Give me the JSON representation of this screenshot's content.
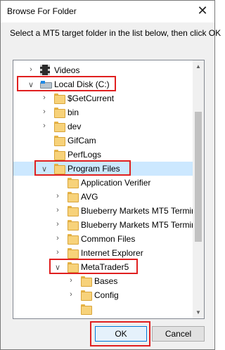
{
  "window": {
    "title": "Browse For Folder",
    "close_glyph": "✕"
  },
  "instruction": "Select a MT5 target folder in the list below, then click OK",
  "tree": {
    "items": [
      {
        "label": "Videos",
        "expanded": false,
        "icon": "video-library-icon"
      },
      {
        "label": "Local Disk (C:)",
        "expanded": true,
        "icon": "drive-icon"
      },
      {
        "label": "$GetCurrent",
        "expanded": false,
        "icon": "folder-icon"
      },
      {
        "label": "bin",
        "expanded": false,
        "icon": "folder-icon"
      },
      {
        "label": "dev",
        "expanded": false,
        "icon": "folder-icon"
      },
      {
        "label": "GifCam",
        "expanded": false,
        "icon": "folder-icon"
      },
      {
        "label": "PerfLogs",
        "expanded": false,
        "icon": "folder-icon"
      },
      {
        "label": "Program Files",
        "expanded": true,
        "icon": "folder-icon"
      },
      {
        "label": "Application Verifier",
        "expanded": false,
        "icon": "folder-icon"
      },
      {
        "label": "AVG",
        "expanded": false,
        "icon": "folder-icon"
      },
      {
        "label": "Blueberry Markets MT5 Termin",
        "expanded": false,
        "icon": "folder-icon"
      },
      {
        "label": "Blueberry Markets MT5 Termin",
        "expanded": false,
        "icon": "folder-icon"
      },
      {
        "label": "Common Files",
        "expanded": false,
        "icon": "folder-icon"
      },
      {
        "label": "Internet Explorer",
        "expanded": false,
        "icon": "folder-icon"
      },
      {
        "label": "MetaTrader5",
        "expanded": true,
        "icon": "folder-icon"
      },
      {
        "label": "Bases",
        "expanded": false,
        "icon": "folder-icon"
      },
      {
        "label": "Config",
        "expanded": false,
        "icon": "folder-icon"
      }
    ]
  },
  "buttons": {
    "ok": "OK",
    "cancel": "Cancel"
  },
  "colors": {
    "highlight": "#e02020",
    "selection": "#cce8ff",
    "folder": "#f7d27a"
  }
}
